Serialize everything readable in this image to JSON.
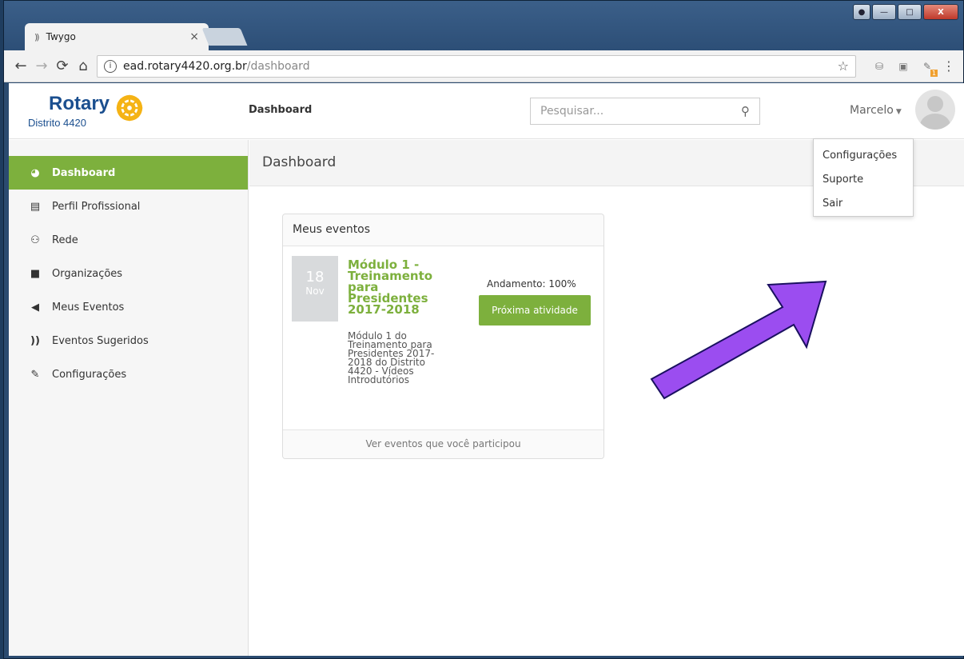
{
  "browser": {
    "tab_title": "Twygo",
    "tab_icon": "))",
    "tab_close": "×",
    "url_host": "ead.rotary4420.org.br",
    "url_path": "/dashboard",
    "ext_badge": "1"
  },
  "header": {
    "logo_text": "Rotary",
    "logo_subtitle": "Distrito 4420",
    "title": "Dashboard",
    "search_placeholder": "Pesquisar...",
    "user_name": "Marcelo"
  },
  "user_dropdown": {
    "items": [
      "Configurações",
      "Suporte",
      "Sair"
    ]
  },
  "sidebar": {
    "items": [
      {
        "label": "Dashboard",
        "icon": "dashboard-icon",
        "active": true
      },
      {
        "label": "Perfil Profissional",
        "icon": "profile-card-icon"
      },
      {
        "label": "Rede",
        "icon": "network-icon"
      },
      {
        "label": "Organizações",
        "icon": "briefcase-icon"
      },
      {
        "label": "Meus Eventos",
        "icon": "megaphone-icon"
      },
      {
        "label": "Eventos Sugeridos",
        "icon": "twygo-icon"
      },
      {
        "label": "Configurações",
        "icon": "pencil-icon"
      }
    ]
  },
  "main": {
    "title": "Dashboard",
    "events_card": {
      "title": "Meus eventos",
      "event": {
        "day": "18",
        "month": "Nov",
        "title": "Módulo 1 - Treinamento para Presidentes 2017-2018",
        "description": "Módulo 1 do Treinamento para Presidentes 2017-2018 do Distrito 4420 - Vídeos Introdutórios",
        "progress_label": "Andamento: 100%",
        "action_label": "Próxima atividade"
      },
      "footer_link": "Ver eventos que você participou"
    }
  },
  "colors": {
    "accent_green": "#7db03d",
    "rotary_blue": "#1b4f8f",
    "rotary_gold": "#f5b315",
    "annotation_arrow": "#9b4df0"
  }
}
